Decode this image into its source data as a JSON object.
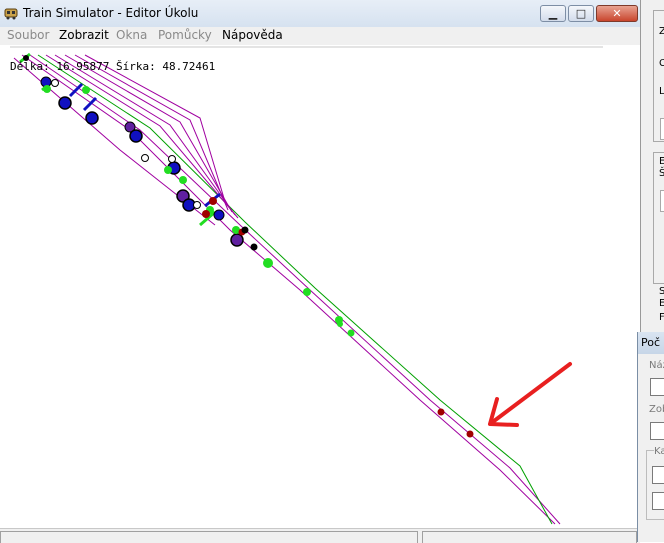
{
  "window": {
    "title": "Train Simulator - Editor Úkolu",
    "minimize_glyph": "▁",
    "maximize_glyph": "□",
    "close_glyph": "✕"
  },
  "menu": [
    {
      "label": "Soubor",
      "enabled": false
    },
    {
      "label": "Zobrazit",
      "enabled": true
    },
    {
      "label": "Okna",
      "enabled": false
    },
    {
      "label": "Pomůcky",
      "enabled": false
    },
    {
      "label": "Nápověda",
      "enabled": true
    }
  ],
  "coords_text": "Délka: 16.95877 Šírka: 48.72461",
  "colors": {
    "track": "#a000a0",
    "track_green": "#00a000",
    "marker_green": "#22dd22",
    "marker_blue": "#1010c0",
    "marker_red": "#a00000",
    "arrow": "#e82020"
  },
  "icons": {
    "app": "train-app-icon",
    "arrow": "red-arrow-annotation"
  },
  "right_panel": {
    "chars": [
      "Z",
      "C",
      "L",
      "E",
      "Š",
      "S",
      "E",
      "F"
    ]
  },
  "dialog2": {
    "title": "Poč",
    "label_1": "Náz",
    "label_2": "Zob",
    "label_3": "Ka"
  }
}
